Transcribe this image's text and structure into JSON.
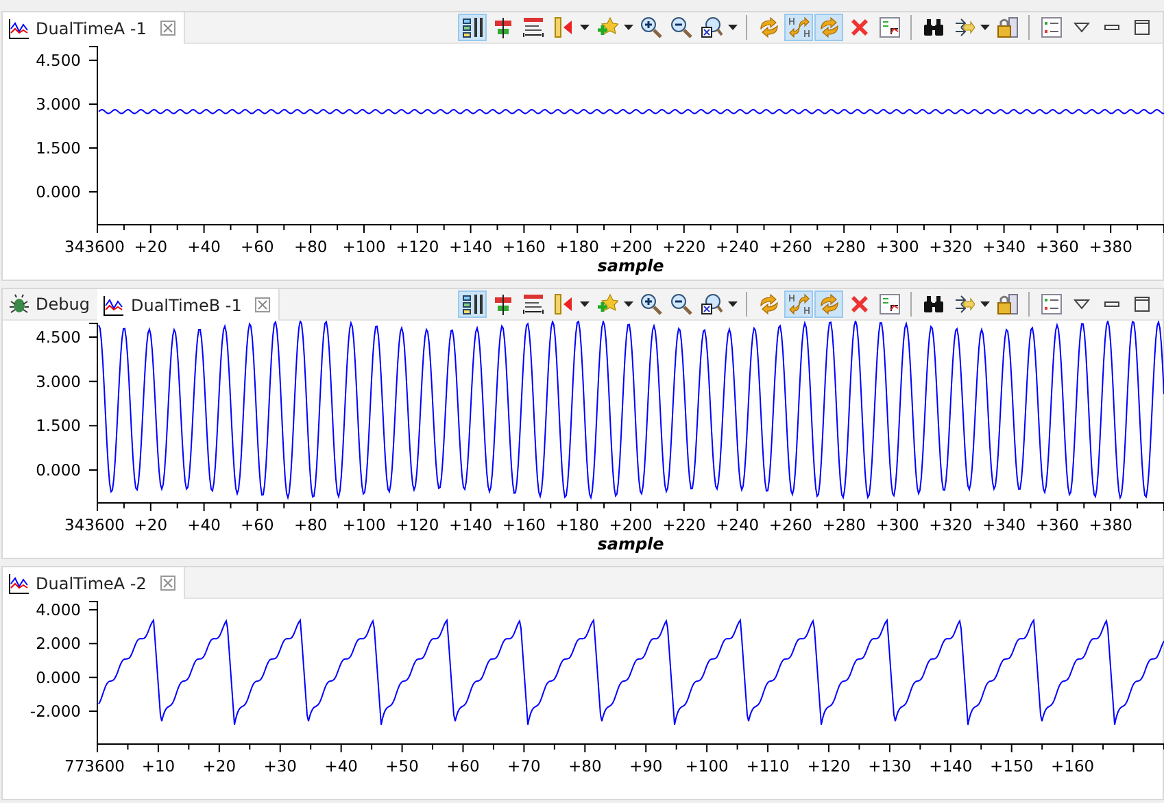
{
  "panels": [
    {
      "tabs": [
        {
          "kind": "chart",
          "label": "DualTimeA -1",
          "selected": true,
          "closable": true
        }
      ],
      "toolbar": true,
      "chart": {
        "kind": "flat",
        "yticks": [
          "4.500",
          "3.000",
          "1.500",
          "0.000"
        ],
        "xticks": [
          "343600",
          "+20",
          "+40",
          "+60",
          "+80",
          "+100",
          "+120",
          "+140",
          "+160",
          "+180",
          "+200",
          "+220",
          "+240",
          "+260",
          "+280",
          "+300",
          "+320",
          "+340",
          "+360",
          "+380"
        ],
        "xlabel": "sample"
      }
    },
    {
      "tabs": [
        {
          "kind": "debug",
          "label": "Debug",
          "selected": false,
          "closable": false
        },
        {
          "kind": "chart",
          "label": "DualTimeB -1",
          "selected": true,
          "closable": true
        }
      ],
      "toolbar": true,
      "chart": {
        "kind": "sine",
        "yticks": [
          "4.500",
          "3.000",
          "1.500",
          "0.000"
        ],
        "xticks": [
          "343600",
          "+20",
          "+40",
          "+60",
          "+80",
          "+100",
          "+120",
          "+140",
          "+160",
          "+180",
          "+200",
          "+220",
          "+240",
          "+260",
          "+280",
          "+300",
          "+320",
          "+340",
          "+360",
          "+380"
        ],
        "xlabel": "sample"
      }
    },
    {
      "tabs": [
        {
          "kind": "chart",
          "label": "DualTimeA -2",
          "selected": true,
          "closable": true
        }
      ],
      "toolbar": false,
      "chart": {
        "kind": "saw",
        "yticks": [
          "4.000",
          "2.000",
          "0.000",
          "-2.000"
        ],
        "xticks": [
          "773600",
          "+10",
          "+20",
          "+30",
          "+40",
          "+50",
          "+60",
          "+70",
          "+80",
          "+90",
          "+100",
          "+110",
          "+120",
          "+130",
          "+140",
          "+150",
          "+160"
        ]
      }
    }
  ],
  "toolbar_items": [
    {
      "kind": "columns",
      "selected": true,
      "dropdown": false
    },
    {
      "kind": "align",
      "selected": false,
      "dropdown": false
    },
    {
      "kind": "range",
      "selected": false,
      "dropdown": false
    },
    {
      "kind": "marker",
      "selected": false,
      "dropdown": true
    },
    {
      "kind": "star",
      "selected": false,
      "dropdown": true
    },
    {
      "kind": "zoomin",
      "selected": false,
      "dropdown": false
    },
    {
      "kind": "zoomout",
      "selected": false,
      "dropdown": false
    },
    {
      "kind": "zoomfit",
      "selected": false,
      "dropdown": true
    },
    {
      "kind": "sep"
    },
    {
      "kind": "sync",
      "selected": false,
      "dropdown": false
    },
    {
      "kind": "synch",
      "selected": true,
      "dropdown": false
    },
    {
      "kind": "syncv",
      "selected": true,
      "dropdown": false
    },
    {
      "kind": "delete",
      "selected": false,
      "dropdown": false
    },
    {
      "kind": "graph",
      "selected": false,
      "dropdown": false
    },
    {
      "kind": "sep"
    },
    {
      "kind": "binoculars",
      "selected": false,
      "dropdown": false
    },
    {
      "kind": "arrows",
      "selected": false,
      "dropdown": true
    },
    {
      "kind": "lock",
      "selected": false,
      "dropdown": false
    },
    {
      "kind": "sep"
    },
    {
      "kind": "list",
      "selected": false,
      "dropdown": false
    },
    {
      "kind": "viewmenu",
      "selected": false,
      "dropdown": false
    },
    {
      "kind": "minimize",
      "selected": false,
      "dropdown": false
    },
    {
      "kind": "maximize",
      "selected": false,
      "dropdown": false
    }
  ]
}
